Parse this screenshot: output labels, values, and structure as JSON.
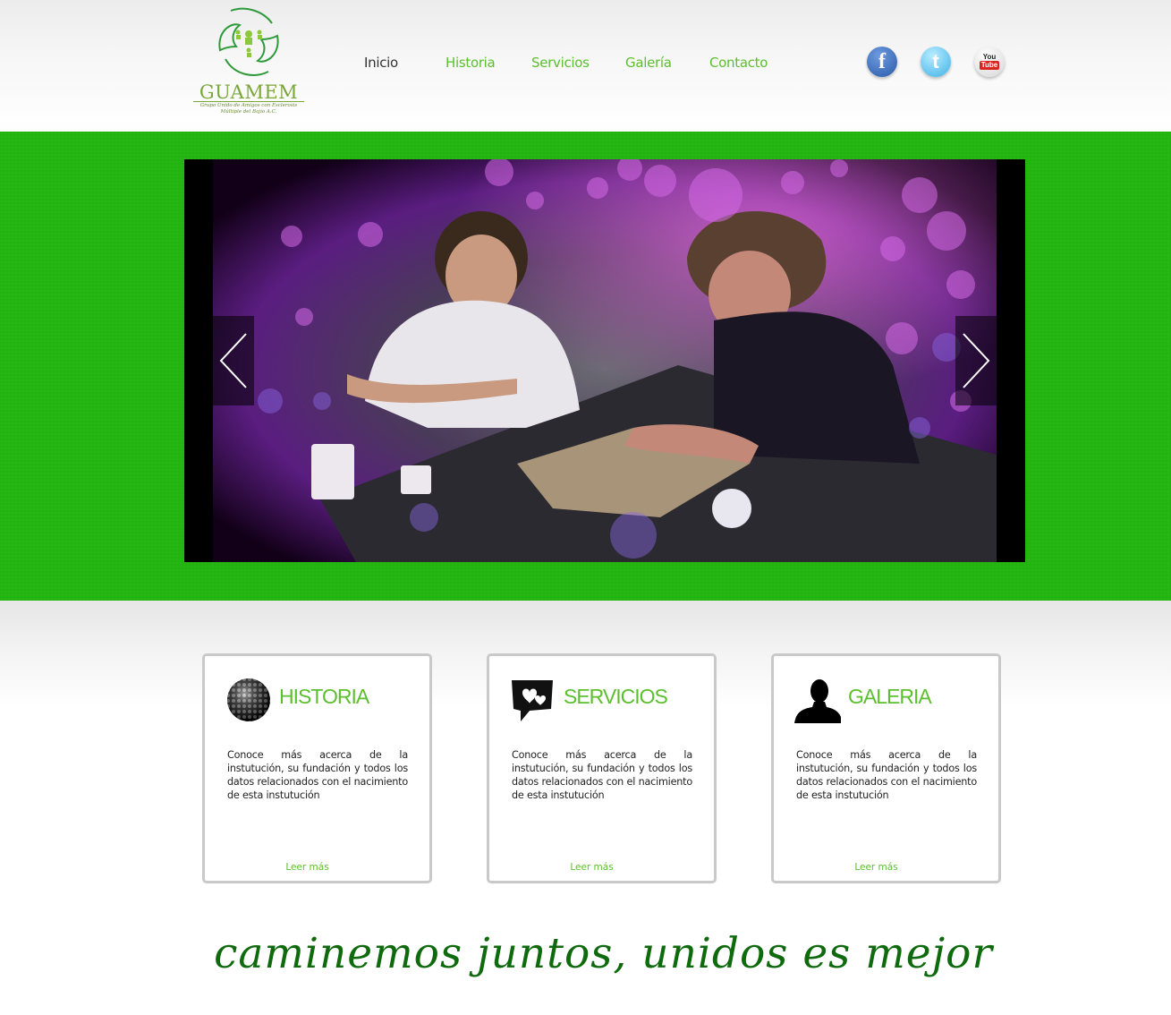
{
  "header": {
    "logo": {
      "name": "GUAMEM",
      "subtitle": "Grupo Unido de Amigos con Esclerosis Múltiple del Bajío A.C.",
      "icon": "hands-people-logo-icon"
    },
    "nav": [
      {
        "label": "Inicio",
        "active": true
      },
      {
        "label": "Historia",
        "active": false
      },
      {
        "label": "Servicios",
        "active": false
      },
      {
        "label": "Galería",
        "active": false
      },
      {
        "label": "Contacto",
        "active": false
      }
    ],
    "social": {
      "facebook": {
        "glyph": "f",
        "icon": "facebook-icon"
      },
      "twitter": {
        "glyph": "t",
        "icon": "twitter-icon"
      },
      "youtube": {
        "you": "You",
        "tube": "Tube",
        "icon": "youtube-icon"
      }
    }
  },
  "hero": {
    "background_color": "#22b40f",
    "slide_description": "photo",
    "prev_icon": "chevron-left-icon",
    "next_icon": "chevron-right-icon"
  },
  "cards": [
    {
      "title": "HISTORIA",
      "icon": "globe-sphere-icon",
      "text": "Conoce más acerca de la instutución, su fundación y todos los datos relacionados con el nacimiento de esta instutución",
      "link": "Leer más"
    },
    {
      "title": "SERVICIOS",
      "icon": "hearts-chat-icon",
      "text": "Conoce más acerca de la instutución, su fundación y todos los datos relacionados con el nacimiento de esta instutución",
      "link": "Leer más"
    },
    {
      "title": "GALERIA",
      "icon": "person-silhouette-icon",
      "text": "Conoce más acerca de la instutución, su fundación y todos los datos relacionados con el nacimiento de esta instutución",
      "link": "Leer más"
    }
  ],
  "tagline": "caminemos juntos, unidos es mejor",
  "colors": {
    "accent_green": "#5cbf2e",
    "hero_green": "#22b40f",
    "tagline_green": "#0e6a0c",
    "nav_active": "#333333"
  }
}
